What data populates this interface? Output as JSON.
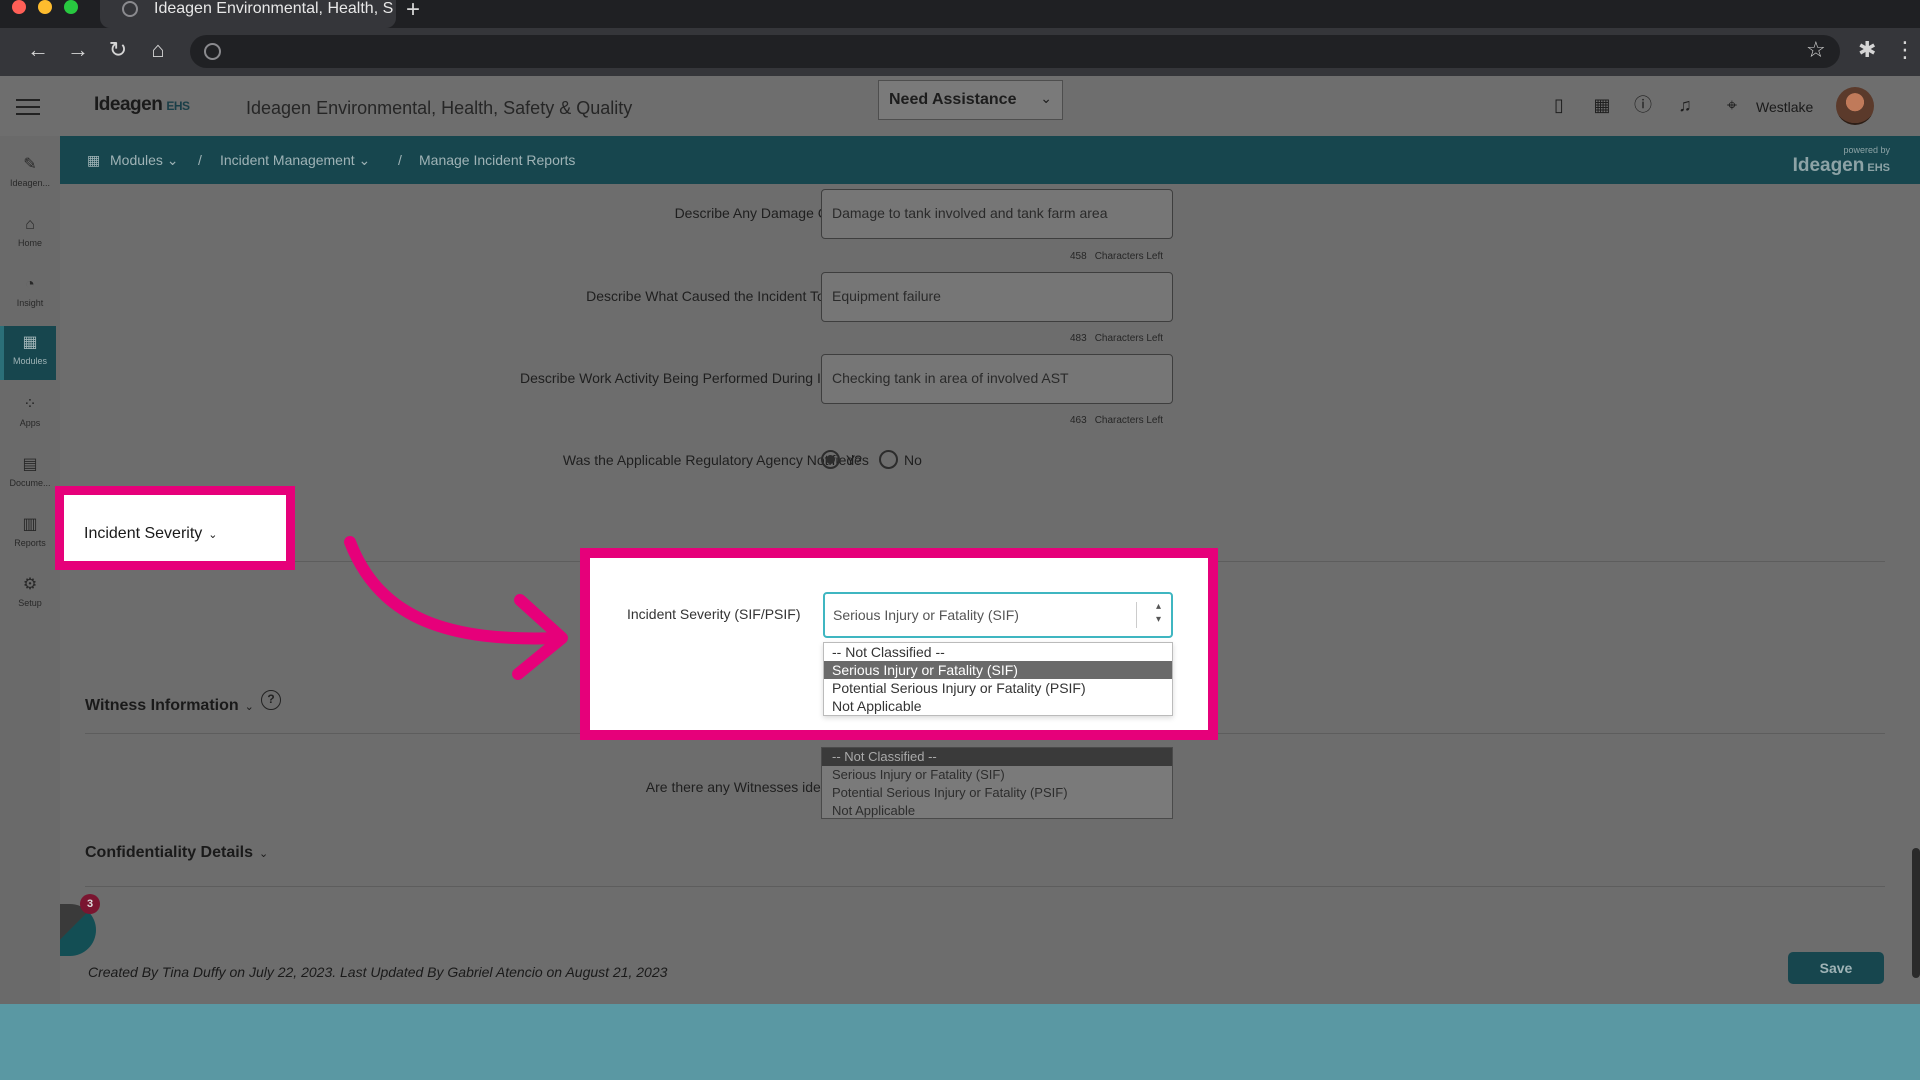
{
  "browser": {
    "tab_title": "Ideagen Environmental, Health, S",
    "new_tab": "+",
    "controls": {
      "back": "←",
      "forward": "→",
      "reload": "↻",
      "home": "⌂",
      "star": "☆",
      "extensions": "✱",
      "menu": "⋮"
    },
    "traffic_colors": [
      "#ff5f57",
      "#febc2e",
      "#28c840"
    ]
  },
  "header": {
    "logo_text": "Ideagen",
    "logo_suffix": "EHS",
    "app_title": "Ideagen Environmental, Health, Safety & Quality",
    "assistance_label": "Need Assistance",
    "location": "Westlake",
    "icons": [
      "mobile-icon",
      "calendar-icon",
      "help-icon",
      "bell-icon",
      "location-pin-icon"
    ]
  },
  "breadcrumb": {
    "modules": "Modules",
    "separator": "/",
    "incident_management": "Incident Management",
    "current": "Manage Incident Reports",
    "powered_by": "powered by",
    "powered_logo": "Ideagen",
    "powered_suffix": "EHS"
  },
  "sidebar": {
    "items": [
      {
        "label": "Ideagen...",
        "icon": "ideagen-icon"
      },
      {
        "label": "Home",
        "icon": "home-icon"
      },
      {
        "label": "Insight",
        "icon": "insight-icon"
      },
      {
        "label": "Modules",
        "icon": "modules-icon",
        "active": true
      },
      {
        "label": "Apps",
        "icon": "apps-icon"
      },
      {
        "label": "Docume...",
        "icon": "document-icon"
      },
      {
        "label": "Reports",
        "icon": "reports-icon"
      },
      {
        "label": "Setup",
        "icon": "setup-icon"
      }
    ]
  },
  "form": {
    "damage": {
      "label": "Describe Any Damage Caused",
      "value": "Damage to tank involved and tank farm area",
      "chars_left": "458",
      "chars_text": "Characters Left"
    },
    "cause": {
      "label": "Describe What Caused the Incident To Occur",
      "value": "Equipment failure",
      "chars_left": "483",
      "chars_text": "Characters Left"
    },
    "activity": {
      "label": "Describe Work Activity Being Performed During Incident",
      "value": "Checking tank in area of involved AST",
      "chars_left": "463",
      "chars_text": "Characters Left"
    },
    "agency": {
      "label": "Was the Applicable Regulatory Agency Notified?",
      "yes": "Yes",
      "no": "No",
      "selected": "Yes"
    }
  },
  "sections": {
    "incident_severity": "Incident Severity",
    "witness": "Witness Information",
    "witness_help": "?",
    "witness_question": "Are there any Witnesses identified?",
    "confidentiality": "Confidentiality Details"
  },
  "severity": {
    "label": "Incident Severity (SIF/PSIF)",
    "selected": "Serious Injury or Fatality (SIF)",
    "options": [
      "-- Not Classified --",
      "Serious Injury or Fatality (SIF)",
      "Potential Serious Injury or Fatality (PSIF)",
      "Not Applicable"
    ]
  },
  "footer": {
    "audit_text": "Created By Tina Duffy on July 22, 2023. Last Updated By Gabriel Atencio on August 21, 2023",
    "save_label": "Save",
    "widget_badge": "3"
  },
  "highlight_color": "#e6007a",
  "accent_color": "#17464e"
}
